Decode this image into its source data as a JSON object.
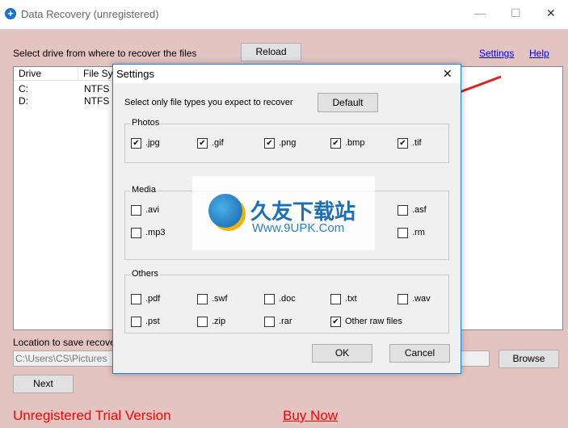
{
  "window": {
    "title": "Data Recovery (unregistered)"
  },
  "main": {
    "select_label": "Select drive from where to recover the files",
    "reload": "Reload",
    "settings_link": "Settings",
    "help_link": "Help",
    "columns": [
      "Drive",
      "File Sys"
    ],
    "drives": [
      {
        "drive": "C:",
        "fs": "NTFS"
      },
      {
        "drive": "D:",
        "fs": "NTFS"
      }
    ],
    "location_label": "Location to save recove",
    "location_value": "C:\\Users\\CS\\Pictures",
    "browse": "Browse",
    "next": "Next",
    "trial": "Unregistered Trial Version",
    "buy": "Buy Now"
  },
  "settings": {
    "title": "Settings",
    "hint": "Select only file types you expect to recover",
    "default": "Default",
    "photos": {
      "label": "Photos",
      "items": [
        {
          "ext": ".jpg",
          "checked": true
        },
        {
          "ext": ".gif",
          "checked": true
        },
        {
          "ext": ".png",
          "checked": true
        },
        {
          "ext": ".bmp",
          "checked": true
        },
        {
          "ext": ".tif",
          "checked": true
        }
      ]
    },
    "media": {
      "label": "Media",
      "items": [
        {
          "ext": ".avi",
          "checked": false
        },
        {
          "ext": ".mp3",
          "checked": false
        },
        {
          "ext": ".asf",
          "checked": false
        },
        {
          "ext": ".rm",
          "checked": false
        }
      ]
    },
    "others": {
      "label": "Others",
      "items": [
        {
          "ext": ".pdf",
          "checked": false
        },
        {
          "ext": ".swf",
          "checked": false
        },
        {
          "ext": ".doc",
          "checked": false
        },
        {
          "ext": ".txt",
          "checked": false
        },
        {
          "ext": ".wav",
          "checked": false
        },
        {
          "ext": ".pst",
          "checked": false
        },
        {
          "ext": ".zip",
          "checked": false
        },
        {
          "ext": ".rar",
          "checked": false
        },
        {
          "ext": "Other raw files",
          "checked": true
        }
      ]
    },
    "ok": "OK",
    "cancel": "Cancel"
  },
  "watermark": {
    "text": "久友下载站",
    "url": "Www.9UPK.Com"
  },
  "colors": {
    "background": "#e4c4c1",
    "trial": "#ff0000",
    "accent": "#1883d7"
  }
}
